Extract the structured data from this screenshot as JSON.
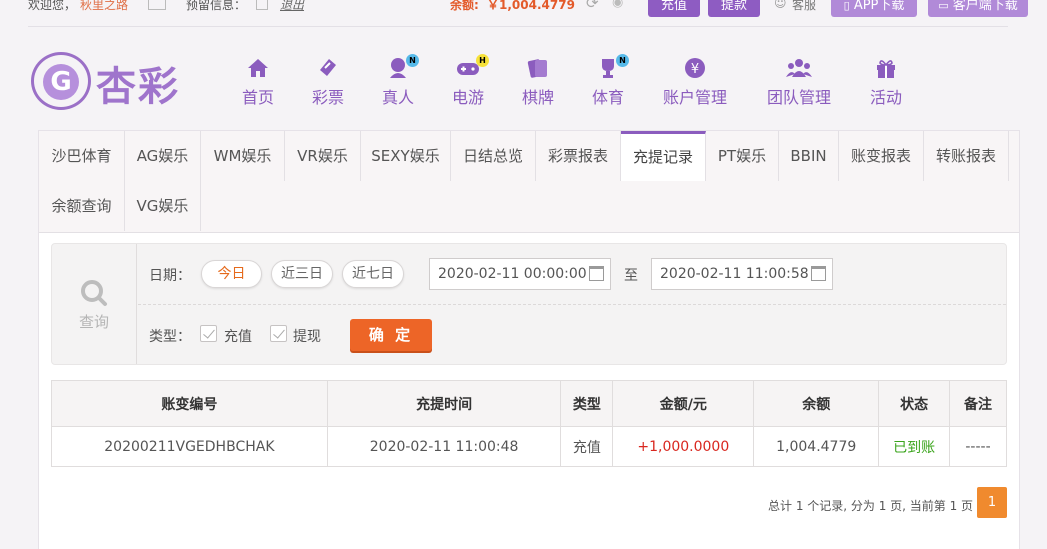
{
  "topbar": {
    "welcome_label": "欢迎您，",
    "username": "秋里之路",
    "notice_label": "预留信息：",
    "logout": "退出",
    "balance_label": "余额:",
    "balance_value": "￥1,004.4779",
    "recharge": "充值",
    "withdraw": "提款",
    "service": "客服",
    "app_download": "APP下载",
    "client_download": "客户端下载"
  },
  "logo": {
    "text": "杏彩"
  },
  "nav": [
    {
      "label": "首页",
      "icon": "home-icon"
    },
    {
      "label": "彩票",
      "icon": "lottery-icon"
    },
    {
      "label": "真人",
      "icon": "live-dealer-icon",
      "badge": "N"
    },
    {
      "label": "电游",
      "icon": "gamepad-icon",
      "badge": "H"
    },
    {
      "label": "棋牌",
      "icon": "cards-icon"
    },
    {
      "label": "体育",
      "icon": "trophy-icon",
      "badge": "N"
    },
    {
      "label": "账户管理",
      "icon": "yen-icon"
    },
    {
      "label": "团队管理",
      "icon": "team-icon"
    },
    {
      "label": "活动",
      "icon": "gift-icon"
    }
  ],
  "tabs": [
    "沙巴体育",
    "AG娱乐",
    "WM娱乐",
    "VR娱乐",
    "SEXY娱乐",
    "日结总览",
    "彩票报表",
    "充提记录",
    "PT娱乐",
    "BBIN",
    "账变报表",
    "转账报表",
    "余额查询",
    "VG娱乐"
  ],
  "active_tab": "充提记录",
  "query": {
    "title": "查询",
    "date_label": "日期：",
    "quick_ranges": [
      "今日",
      "近三日",
      "近七日"
    ],
    "selected_range": "今日",
    "start_date": "2020-02-11 00:00:00",
    "to_label": "至",
    "end_date": "2020-02-11 11:00:58",
    "type_label": "类型：",
    "type_recharge": "充值",
    "type_withdraw": "提现",
    "confirm": "确 定"
  },
  "table": {
    "headers": [
      "账变编号",
      "充提时间",
      "类型",
      "金额/元",
      "余额",
      "状态",
      "备注"
    ],
    "rows": [
      [
        "20200211VGEDHBCHAK",
        "2020-02-11 11:00:48",
        "充值",
        "+1,000.0000",
        "1,004.4779",
        "已到账",
        "-----"
      ]
    ]
  },
  "pager": {
    "summary": "总计 1 个记录, 分为 1 页, 当前第 1 页",
    "current_page": "1"
  },
  "colors": {
    "brand": "#8b5cbe",
    "accent_orange": "#ed6527",
    "amount_red": "#d9271f",
    "status_green": "#3aa41c"
  }
}
